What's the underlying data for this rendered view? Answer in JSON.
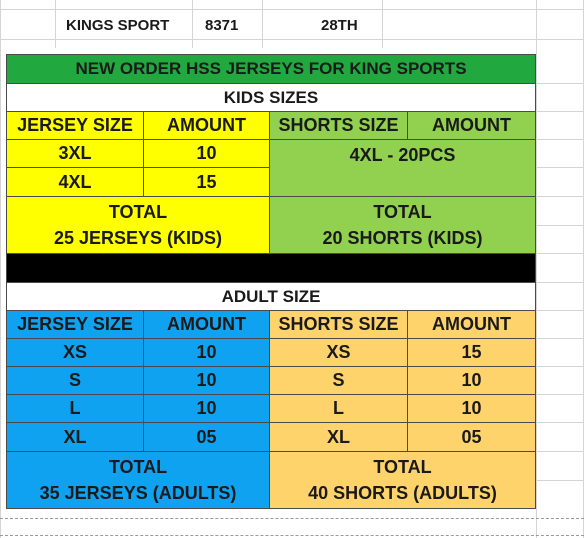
{
  "top_row": {
    "store": "KINGS SPORT",
    "number": "8371",
    "date": "28TH"
  },
  "order_title": "NEW ORDER HSS JERSEYS FOR KING SPORTS",
  "kids": {
    "section_title": "KIDS SIZES",
    "jersey_size_header": "JERSEY SIZE",
    "amount_header": "AMOUNT",
    "shorts_size_header": "SHORTS SIZE",
    "shorts_amount_header": "AMOUNT",
    "jerseys": [
      {
        "size": "3XL",
        "amount": "10"
      },
      {
        "size": "4XL",
        "amount": "15"
      }
    ],
    "shorts_note": "4XL - 20PCS",
    "jersey_total_label": "TOTAL",
    "jersey_total_value": "25 JERSEYS (KIDS)",
    "shorts_total_label": "TOTAL",
    "shorts_total_value": "20 SHORTS (KIDS)"
  },
  "adult": {
    "section_title": "ADULT SIZE",
    "jersey_size_header": "JERSEY SIZE",
    "amount_header": "AMOUNT",
    "shorts_size_header": "SHORTS SIZE",
    "shorts_amount_header": "AMOUNT",
    "jerseys": [
      {
        "size": "XS",
        "amount": "10"
      },
      {
        "size": "S",
        "amount": "10"
      },
      {
        "size": "L",
        "amount": "10"
      },
      {
        "size": "XL",
        "amount": "05"
      }
    ],
    "shorts": [
      {
        "size": "XS",
        "amount": "15"
      },
      {
        "size": "S",
        "amount": "10"
      },
      {
        "size": "L",
        "amount": "10"
      },
      {
        "size": "XL",
        "amount": "05"
      }
    ],
    "jersey_total_label": "TOTAL",
    "jersey_total_value": "35 JERSEYS (ADULTS)",
    "shorts_total_label": "TOTAL",
    "shorts_total_value": "40 SHORTS (ADULTS)"
  },
  "colors": {
    "title_bar": "#21a83f",
    "kids_jersey": "#ffff00",
    "kids_shorts": "#92d050",
    "adult_jersey": "#0fa2f0",
    "adult_shorts": "#ffd36b",
    "separator": "#000000"
  }
}
